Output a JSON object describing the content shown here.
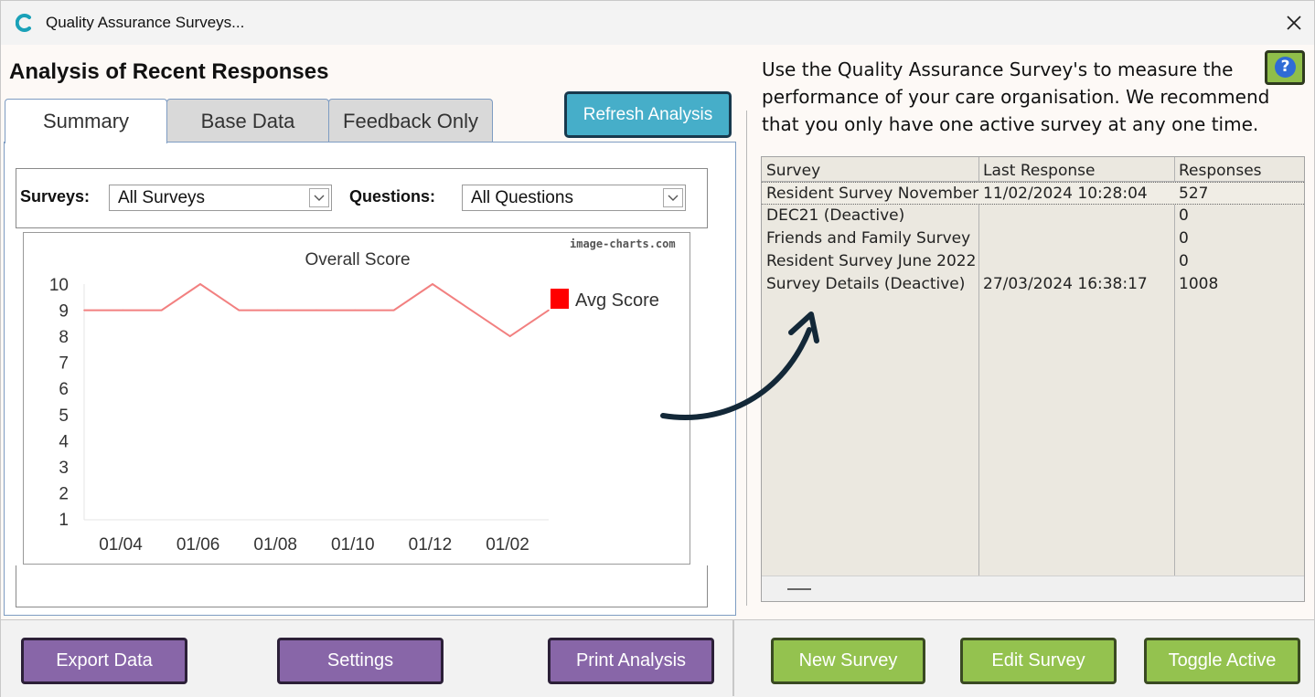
{
  "window": {
    "title": "Quality Assurance Surveys...",
    "close_glyph": "✕",
    "app_icon": "c-logo-icon"
  },
  "heading": "Analysis of Recent Responses",
  "tabs": [
    {
      "label": "Summary",
      "active": true
    },
    {
      "label": "Base Data",
      "active": false
    },
    {
      "label": "Feedback Only",
      "active": false
    }
  ],
  "refresh_label": "Refresh Analysis",
  "filters": {
    "surveys_label": "Surveys:",
    "surveys_value": "All Surveys",
    "questions_label": "Questions:",
    "questions_value": "All Questions"
  },
  "chart_watermark": "image-charts.com",
  "chart_data": {
    "type": "line",
    "title": "Overall Score",
    "categories": [
      "01/04",
      "01/06",
      "01/08",
      "01/10",
      "01/12",
      "01/02"
    ],
    "x_points": 13,
    "series": [
      {
        "name": "Avg Score",
        "color": "#f28080",
        "values": [
          9,
          9,
          9,
          10,
          9,
          9,
          9,
          9,
          9,
          10,
          9,
          8,
          9
        ]
      }
    ],
    "yticks": [
      1,
      2,
      3,
      4,
      5,
      6,
      7,
      8,
      9,
      10
    ],
    "ylim": [
      1,
      10
    ],
    "legend_position": "right",
    "legend_color": "#ff0000",
    "grid": false
  },
  "intro_text": "Use the Quality Assurance Survey's to measure the performance of your care organisation.  We recommend that you only have one active survey at any one time.",
  "help_glyph": "?",
  "table": {
    "columns": [
      "Survey",
      "Last Response",
      "Responses"
    ],
    "rows": [
      {
        "survey": "Resident Survey November",
        "last": "11/02/2024 10:28:04",
        "responses": "527",
        "selected": true
      },
      {
        "survey": "DEC21 (Deactive)",
        "last": "",
        "responses": "0",
        "selected": false
      },
      {
        "survey": "Friends and Family Survey",
        "last": "",
        "responses": "0",
        "selected": false
      },
      {
        "survey": "Resident Survey June 2022",
        "last": "",
        "responses": "0",
        "selected": false
      },
      {
        "survey": "Survey Details (Deactive)",
        "last": "27/03/2024 16:38:17",
        "responses": "1008",
        "selected": false
      }
    ]
  },
  "footer_buttons": {
    "export": "Export Data",
    "settings": "Settings",
    "print": "Print Analysis",
    "new": "New Survey",
    "edit": "Edit Survey",
    "toggle": "Toggle Active"
  },
  "colors": {
    "refresh": "#46aec9",
    "purple_button": "#8866a8",
    "green_button": "#94c24f",
    "table_bg": "#ebe8e0",
    "arrow": "#132838"
  }
}
